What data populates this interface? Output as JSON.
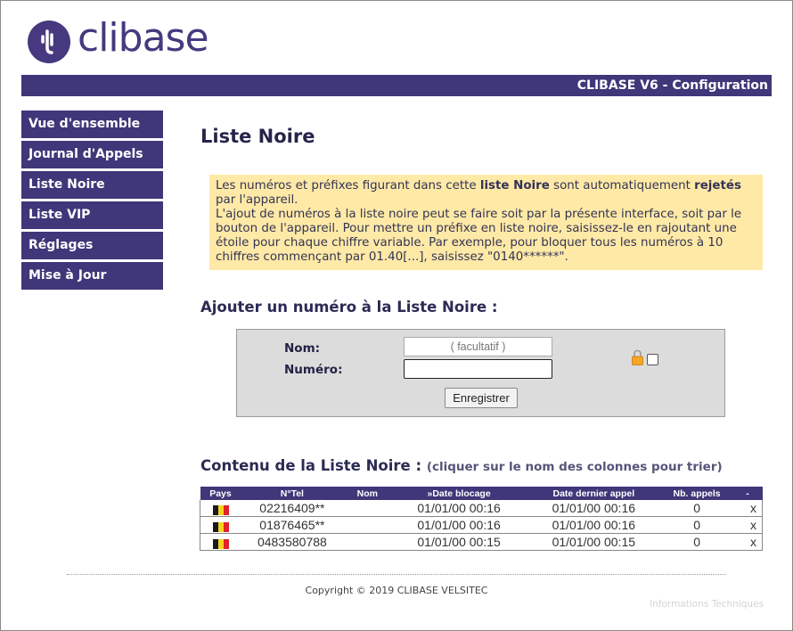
{
  "brand": {
    "logo_text": "clibase"
  },
  "header": {
    "title": "CLIBASE V6 - Configuration"
  },
  "sidebar": {
    "items": [
      {
        "label": "Vue d'ensemble"
      },
      {
        "label": "Journal d'Appels"
      },
      {
        "label": "Liste Noire"
      },
      {
        "label": "Liste VIP"
      },
      {
        "label": "Réglages"
      },
      {
        "label": "Mise à Jour"
      }
    ]
  },
  "main": {
    "title": "Liste Noire",
    "info": {
      "p1_a": "Les numéros et préfixes figurant dans cette ",
      "p1_b": "liste Noire",
      "p1_c": " sont automatiquement ",
      "p1_d": "rejetés",
      "p1_e": " par l'appareil.",
      "p2": "L'ajout de numéros à la liste noire peut se faire soit par la présente interface, soit par le bouton de l'appareil. Pour mettre un préfixe en liste noire, saisissez-le en rajoutant une étoile pour chaque chiffre variable. Par exemple, pour bloquer tous les numéros à 10 chiffres commençant par 01.40[...], saisissez \"0140******\"."
    },
    "add_section": {
      "title": "Ajouter un numéro à la Liste Noire :",
      "nom_label": "Nom:",
      "nom_placeholder": "( facultatif )",
      "numero_label": "Numéro:",
      "numero_value": "",
      "save_label": "Enregistrer"
    },
    "list_section": {
      "title": "Contenu de la Liste Noire :",
      "hint": "(cliquer sur le nom des colonnes pour trier)",
      "columns": [
        "Pays",
        "N°Tel",
        "Nom",
        "»Date blocage",
        "Date dernier appel",
        "Nb. appels",
        "-"
      ],
      "rows": [
        {
          "country": "BE",
          "tel": "02216409**",
          "nom": "",
          "date_blocage": "01/01/00 00:16",
          "date_dernier": "01/01/00 00:16",
          "nb": "0",
          "del": "x"
        },
        {
          "country": "BE",
          "tel": "01876465**",
          "nom": "",
          "date_blocage": "01/01/00 00:16",
          "date_dernier": "01/01/00 00:16",
          "nb": "0",
          "del": "x"
        },
        {
          "country": "BE",
          "tel": "0483580788",
          "nom": "",
          "date_blocage": "01/01/00 00:15",
          "date_dernier": "01/01/00 00:15",
          "nb": "0",
          "del": "x"
        }
      ]
    }
  },
  "footer": {
    "copyright": "Copyright © 2019 CLIBASE VELSITEC",
    "tech_link": "Informations Techniques"
  },
  "colors": {
    "brand": "#46397f",
    "nav_bg": "#3f3779",
    "info_bg": "#ffe9a6",
    "form_bg": "#dcdcdc",
    "flag_black": "#1a1a1a",
    "flag_yellow": "#f4d21f",
    "flag_red": "#e0232b"
  },
  "icons": {
    "logo": "clibase-logo-icon",
    "lock": "padlock-icon",
    "flag": "belgium-flag-icon"
  }
}
